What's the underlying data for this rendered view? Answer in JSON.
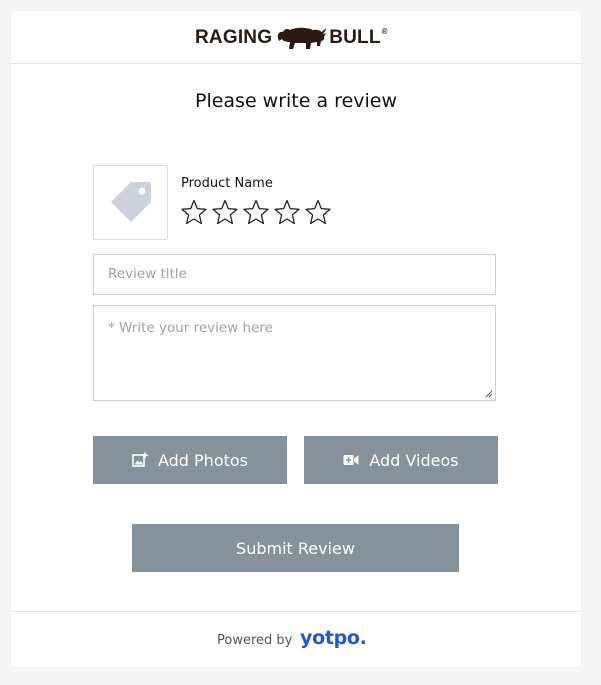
{
  "brand": {
    "logo_left": "RAGING",
    "logo_right": "BULL",
    "logo_mark": "®"
  },
  "form": {
    "title": "Please write a review",
    "product": {
      "name": "Product Name",
      "thumbnail_icon": "tag-icon",
      "rating": {
        "value": 0,
        "max": 5
      }
    },
    "review_title": {
      "value": "",
      "placeholder": "Review title"
    },
    "review_body": {
      "value": "",
      "placeholder": "* Write your review here"
    },
    "buttons": {
      "add_photos": "Add Photos",
      "add_videos": "Add Videos",
      "submit": "Submit Review"
    }
  },
  "footer": {
    "powered_by": "Powered by",
    "provider": "yotpo."
  },
  "colors": {
    "button": "#87919c",
    "yotpo_blue": "#1d59d7",
    "brand_dark": "#2a1a12"
  }
}
